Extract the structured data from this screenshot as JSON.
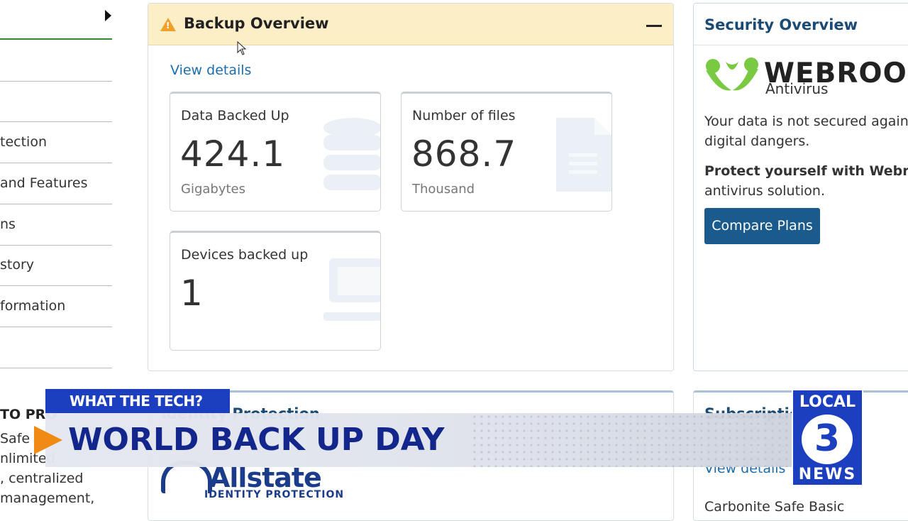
{
  "sidebar": {
    "items": [
      {
        "label": ""
      },
      {
        "label": ""
      },
      {
        "label": "tection"
      },
      {
        "label": "and Features"
      },
      {
        "label": "ns"
      },
      {
        "label": "story"
      },
      {
        "label": "formation"
      },
      {
        "label": ""
      }
    ]
  },
  "backup": {
    "title": "Backup Overview",
    "view_details": "View details",
    "cards": [
      {
        "label": "Data Backed Up",
        "value": "424.1",
        "unit": "Gigabytes",
        "icon": "database-icon"
      },
      {
        "label": "Number of files",
        "value": "868.7",
        "unit": "Thousand",
        "icon": "file-icon"
      },
      {
        "label": "Devices backed up",
        "value": "1",
        "unit": "",
        "icon": "laptop-icon"
      }
    ]
  },
  "security": {
    "title": "Security Overview",
    "brand": "WEBROO",
    "brand_sub": "Antivirus",
    "text_line1": "Your data is not secured agains",
    "text_line2": "digital dangers.",
    "bold_text": "Protect yourself with Webroo",
    "text_line3": "antivirus solution.",
    "button": "Compare Plans"
  },
  "lower_left": {
    "heading": "TO PRO",
    "lines": [
      "Safe P",
      "nlimited",
      ", centralized",
      "management,"
    ]
  },
  "identity": {
    "title": "Identity Protection",
    "brand": "Allstate",
    "brand_sub": "IDENTITY PROTECTION"
  },
  "subscription": {
    "title": "Subscriptio",
    "view_details": "View details",
    "plan": "Carbonite Safe Basic"
  },
  "chyron": {
    "tag": "WHAT THE TECH?",
    "headline": "WORLD BACK UP DAY"
  },
  "station": {
    "top": "LOCAL",
    "number": "3",
    "bottom": "NEWS"
  },
  "colors": {
    "accent_blue": "#1b3fbf",
    "headline_navy": "#13268c",
    "link_blue": "#1c6dab",
    "warning_bg": "#fcefc8",
    "button_blue": "#1b5a8c",
    "webroot_green": "#7ac943"
  }
}
